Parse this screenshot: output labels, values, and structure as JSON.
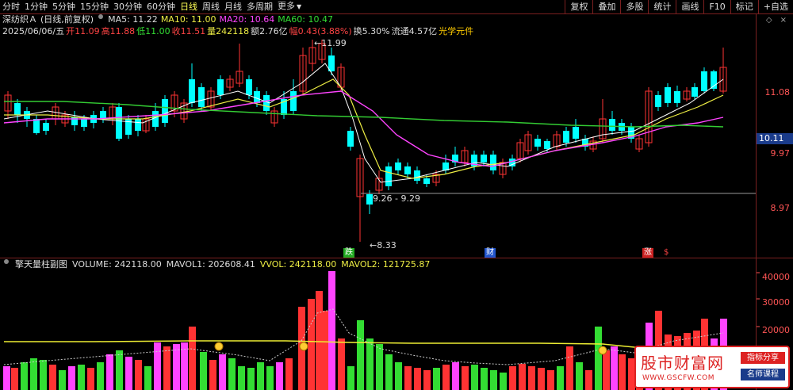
{
  "toolbar": {
    "periods": [
      "分时",
      "1分钟",
      "5分钟",
      "15分钟",
      "30分钟",
      "60分钟",
      "日线",
      "周线",
      "月线",
      "多周期",
      "更多"
    ],
    "active_period": "日线",
    "right_tools": [
      "复权",
      "叠加",
      "多股",
      "统计",
      "画线",
      "F10",
      "标记",
      "+自选"
    ]
  },
  "header": {
    "stock_name": "深纺织Ａ",
    "mode": "(日线,前复权)",
    "ma5": "MA5: 11.22",
    "ma10": "MA10: 11.00",
    "ma20": "MA20: 10.64",
    "ma60": "MA60: 10.47"
  },
  "quote": {
    "date": "2025/06/06/五",
    "open": "开11.09",
    "high": "高11.88",
    "low": "低11.00",
    "close": "收11.51",
    "volume": "量242118",
    "amount": "额2.76亿",
    "change": "幅0.43(3.88%)",
    "turnover": "换5.30%",
    "float": "流通4.57亿",
    "sector": "光学元件"
  },
  "price_axis": {
    "labels": [
      "11.08",
      "9.97",
      "8.97"
    ],
    "current": "10.11"
  },
  "annotations": {
    "high": "11.99",
    "low": "8.33",
    "gap": "9.26 - 9.29"
  },
  "markers": {
    "die": "跌",
    "cai": "财",
    "zhang": "涨",
    "dollar": "$"
  },
  "volume_panel": {
    "title": "擎天量柱副图",
    "volume": "VOLUME: 242118.00",
    "mavol1": "MAVOL1: 202608.41",
    "vvol": "VVOL: 242118.00",
    "mavol2": "MAVOL2: 121725.87",
    "axis_labels": [
      "40000",
      "30000",
      "20000",
      "10000"
    ]
  },
  "watermark": {
    "title": "股市财富网",
    "url": "WWW.GSCFW.COM",
    "tag1": "指标分享",
    "tag2": "名师课程"
  },
  "colors": {
    "up": "#ff3333",
    "down": "#00ffff",
    "ma5": "#ffffff",
    "ma10": "#eeee44",
    "ma20": "#ff44ff",
    "ma60": "#33cc33"
  }
}
